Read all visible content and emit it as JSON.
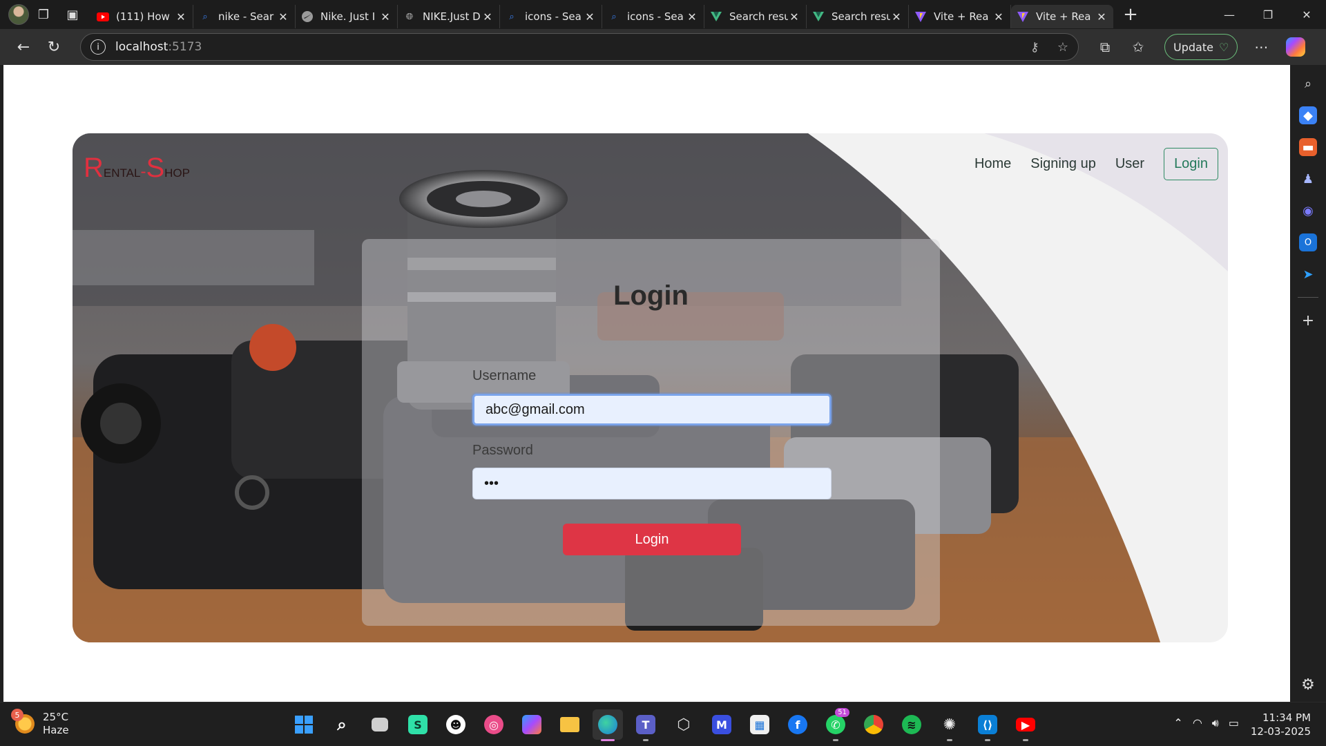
{
  "browser": {
    "tabs": [
      {
        "title": "(111) How",
        "icon": "youtube-icon",
        "color": "#ff0000"
      },
      {
        "title": "nike - Sear",
        "icon": "search-icon",
        "color": "#3b82f6"
      },
      {
        "title": "Nike. Just I",
        "icon": "nike-icon",
        "color": "#bbbbbb"
      },
      {
        "title": "NIKE.Just D",
        "icon": "globe-icon",
        "color": "#cccccc"
      },
      {
        "title": "icons - Sea",
        "icon": "search-icon",
        "color": "#3b82f6"
      },
      {
        "title": "icons - Sea",
        "icon": "search-icon",
        "color": "#3b82f6"
      },
      {
        "title": "Search resu",
        "icon": "vuetify-icon",
        "color": "#42b883"
      },
      {
        "title": "Search resu",
        "icon": "vuetify-icon",
        "color": "#42b883"
      },
      {
        "title": "Vite + Rea",
        "icon": "vite-icon",
        "color": "#bd34fe"
      },
      {
        "title": "Vite + Rea",
        "icon": "vite-icon",
        "color": "#bd34fe"
      }
    ],
    "url_host": "localhost",
    "url_port": ":5173",
    "update_label": "Update"
  },
  "site": {
    "brand": {
      "r": "R",
      "ental": "ental",
      "dash": "-",
      "s": "S",
      "hop": "hop"
    },
    "nav": [
      {
        "label": "Home"
      },
      {
        "label": "Signing up"
      },
      {
        "label": "User"
      }
    ],
    "nav_login": "Login",
    "form": {
      "title": "Login",
      "username_label": "Username",
      "username_value": "abc@gmail.com",
      "password_label": "Password",
      "password_value": "•••",
      "submit_label": "Login"
    },
    "colors": {
      "accent": "#de3545",
      "nav_border": "#2e8a63"
    }
  },
  "taskbar": {
    "weather_temp": "25°C",
    "weather_desc": "Haze",
    "weather_badge": "5",
    "whatsapp_badge": "51",
    "time": "11:34 PM",
    "date": "12-03-2025"
  }
}
